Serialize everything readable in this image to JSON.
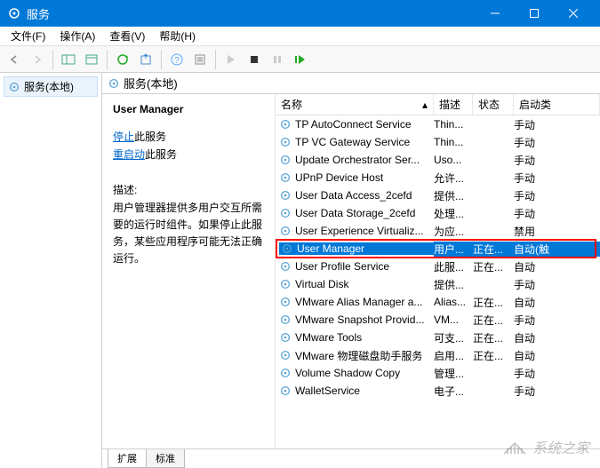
{
  "window": {
    "title": "服务"
  },
  "menu": {
    "file": "文件(F)",
    "action": "操作(A)",
    "view": "查看(V)",
    "help": "帮助(H)"
  },
  "tree": {
    "root": "服务(本地)"
  },
  "pane": {
    "header": "服务(本地)"
  },
  "detail": {
    "serviceName": "User Manager",
    "stopPrefix": "停止",
    "stopSuffix": "此服务",
    "restartPrefix": "重启动",
    "restartSuffix": "此服务",
    "descLabel": "描述:",
    "desc": "用户管理器提供多用户交互所需要的运行时组件。如果停止此服务，某些应用程序可能无法正确运行。"
  },
  "columns": {
    "name": "名称",
    "desc": "描述",
    "status": "状态",
    "start": "启动类"
  },
  "services": [
    {
      "name": "TP AutoConnect Service",
      "desc": "Thin...",
      "status": "",
      "start": "手动"
    },
    {
      "name": "TP VC Gateway Service",
      "desc": "Thin...",
      "status": "",
      "start": "手动"
    },
    {
      "name": "Update Orchestrator Ser...",
      "desc": "Uso...",
      "status": "",
      "start": "手动"
    },
    {
      "name": "UPnP Device Host",
      "desc": "允许...",
      "status": "",
      "start": "手动"
    },
    {
      "name": "User Data Access_2cefd",
      "desc": "提供...",
      "status": "",
      "start": "手动"
    },
    {
      "name": "User Data Storage_2cefd",
      "desc": "处理...",
      "status": "",
      "start": "手动"
    },
    {
      "name": "User Experience Virtualiz...",
      "desc": "为应...",
      "status": "",
      "start": "禁用"
    },
    {
      "name": "User Manager",
      "desc": "用户...",
      "status": "正在...",
      "start": "自动(触",
      "selected": true
    },
    {
      "name": "User Profile Service",
      "desc": "此服...",
      "status": "正在...",
      "start": "自动"
    },
    {
      "name": "Virtual Disk",
      "desc": "提供...",
      "status": "",
      "start": "手动"
    },
    {
      "name": "VMware Alias Manager a...",
      "desc": "Alias...",
      "status": "正在...",
      "start": "自动"
    },
    {
      "name": "VMware Snapshot Provid...",
      "desc": "VM...",
      "status": "正在...",
      "start": "手动"
    },
    {
      "name": "VMware Tools",
      "desc": "可支...",
      "status": "正在...",
      "start": "自动"
    },
    {
      "name": "VMware 物理磁盘助手服务",
      "desc": "启用...",
      "status": "正在...",
      "start": "自动"
    },
    {
      "name": "Volume Shadow Copy",
      "desc": "管理...",
      "status": "",
      "start": "手动"
    },
    {
      "name": "WalletService",
      "desc": "电子...",
      "status": "",
      "start": "手动"
    }
  ],
  "tabs": {
    "extended": "扩展",
    "standard": "标准"
  },
  "watermark": "系统之家"
}
